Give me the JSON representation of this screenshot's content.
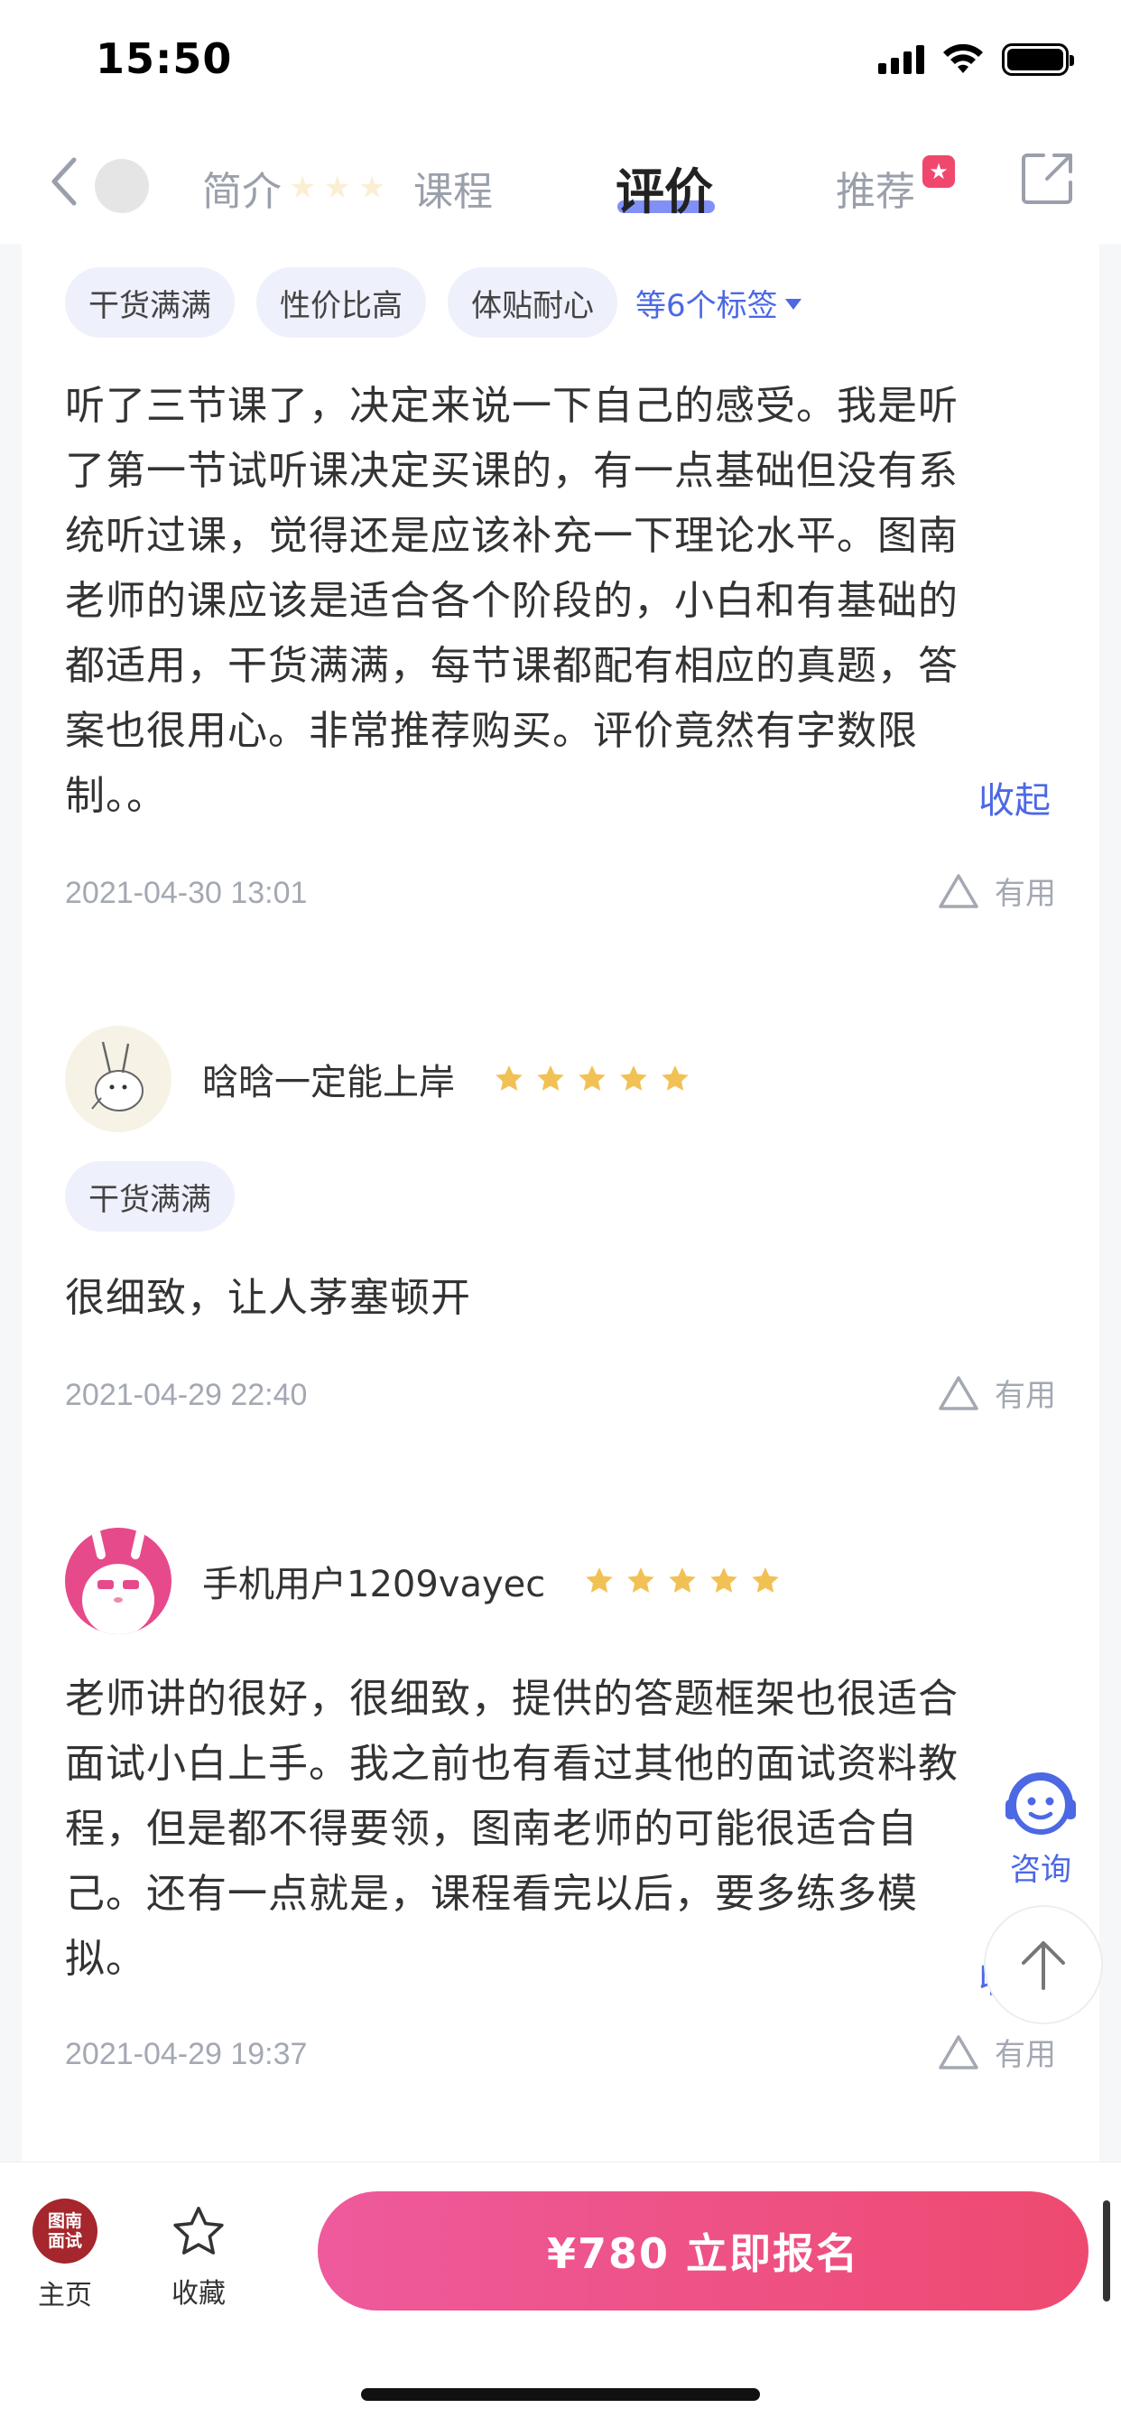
{
  "status_bar": {
    "time": "15:50"
  },
  "header": {
    "tabs": {
      "intro": "简介",
      "course": "课程",
      "review": "评价",
      "recommend": "推荐"
    },
    "recommend_badge": "★"
  },
  "reviews": [
    {
      "tags": [
        "干货满满",
        "性价比高",
        "体贴耐心"
      ],
      "more_tags": "等6个标签",
      "lines": [
        "听了三节课了，决定来说一下自己的感受。我是听",
        "了第一节试听课决定买课的，有一点基础但没有系",
        "统听过课，觉得还是应该补充一下理论水平。图南",
        "老师的课应该是适合各个阶段的，小白和有基础的",
        "都适用，干货满满，每节课都配有相应的真题，答",
        "案也很用心。非常推荐购买。评价竟然有字数限",
        "制。。"
      ],
      "collapse": "收起",
      "date": "2021-04-30 13:01",
      "useful": "有用"
    },
    {
      "username": "晗晗一定能上岸",
      "rating": 5,
      "tags": [
        "干货满满"
      ],
      "lines": [
        "很细致，让人茅塞顿开"
      ],
      "date": "2021-04-29 22:40",
      "useful": "有用"
    },
    {
      "username": "手机用户1209vayec",
      "rating": 5,
      "lines": [
        "老师讲的很好，很细致，提供的答题框架也很适合",
        "面试小白上手。我之前也有看过其他的面试资料教",
        "程，但是都不得要领，图南老师的可能很适合自",
        "己。还有一点就是，课程看完以后，要多练多模",
        "拟。"
      ],
      "collapse": "收起",
      "date": "2021-04-29 19:37",
      "useful": "有用"
    }
  ],
  "floating": {
    "consult_label": "咨询"
  },
  "bottom_bar": {
    "home_logo_line1": "图南",
    "home_logo_line2": "面试",
    "home_label": "主页",
    "favorite_label": "收藏",
    "enroll_label": "¥780  立即报名"
  },
  "colors": {
    "accent_blue": "#4c68e4",
    "star_yellow": "#f2c155",
    "enroll_pink": "#ee4a70",
    "tag_bg": "#eef0fb"
  },
  "icons": [
    "back-arrow-icon",
    "share-icon",
    "star-icon",
    "useful-triangle-icon",
    "consult-robot-icon",
    "arrow-up-icon",
    "favorite-star-icon",
    "wifi-icon",
    "battery-icon",
    "signal-icon"
  ]
}
